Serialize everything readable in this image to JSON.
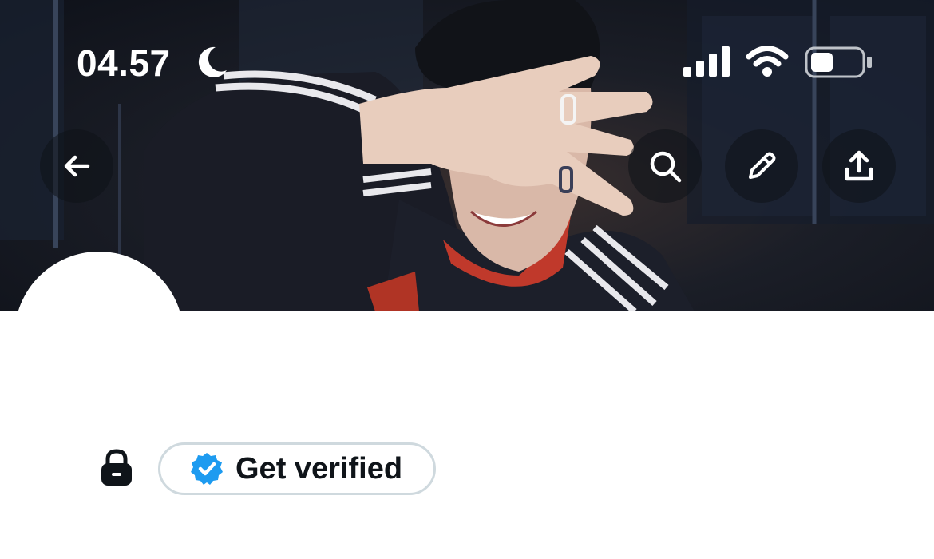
{
  "status_bar": {
    "time": "04.57",
    "focus_mode_icon": "moon-icon",
    "signal_icon": "cellular-signal-icon",
    "wifi_icon": "wifi-icon",
    "battery_icon": "battery-icon",
    "battery_level": 0.45
  },
  "toolbar": {
    "back_icon": "arrow-left-icon",
    "search_icon": "search-icon",
    "edit_icon": "pencil-icon",
    "share_icon": "share-icon"
  },
  "profile": {
    "lock_icon": "lock-icon",
    "verify_badge_icon": "verified-badge-icon",
    "verify_label": "Get verified"
  },
  "colors": {
    "verified_blue": "#1d9bf0",
    "pill_border": "#cfd9de",
    "text_primary": "#0f1419",
    "icon_white": "#ffffff"
  }
}
